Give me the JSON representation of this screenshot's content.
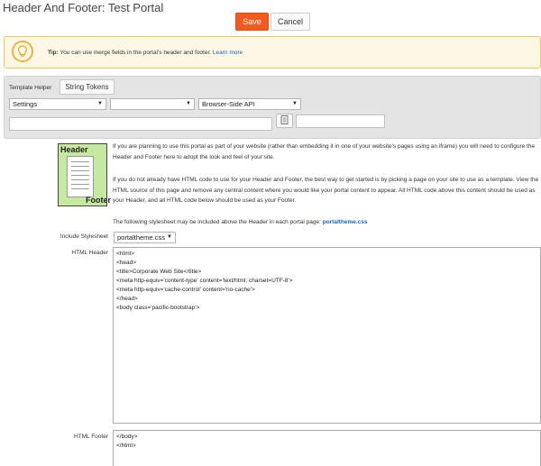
{
  "page": {
    "title": "Header And Footer: Test Portal"
  },
  "actions": {
    "save_label": "Save",
    "cancel_label": "Cancel"
  },
  "tip": {
    "prefix": "Tip:",
    "text": "You can use merge fields in the portal's header and footer.",
    "link": "Learn more"
  },
  "template_helper": {
    "label": "Template Helper",
    "tab_label": "String Tokens",
    "select1_value": "Settings",
    "select2_value": "",
    "select3_value": "Browser-Side API"
  },
  "image": {
    "header_label": "Header",
    "footer_label": "Footer"
  },
  "instructions": {
    "para1": "If you are planning to use this portal as part of your website (rather than embedding it in one of your website's pages using an iframe) you will need to configure the Header and Footer here to adopt the look and feel of your site.",
    "para2": "If you do not already have HTML code to use for your Header and Footer, the best way to get started is by picking a page on your site to use as a template. View the HTML source of this page and remove any central content where you would like your portal content to appear. All HTML code above this content should be used as your Header, and all HTML code below should be used as your Footer.",
    "para3_text": "The following stylesheet may be included above the Header in each portal page:",
    "para3_link": "portaltheme.css"
  },
  "form": {
    "stylesheet_label": "Include Stylesheet",
    "stylesheet_value": "portaltheme.css",
    "html_header_label": "HTML Header",
    "html_header_value": "<html>\n<head>\n<title>Corporate Web Site</title>\n<meta http-equiv='content-type' content='text/html; charset=UTF-8'>\n<meta http-equiv='cache-control' content='no-cache'>\n</head>\n<body class='pacific-bootstrap'>",
    "html_footer_label": "HTML Footer",
    "html_footer_value": "</body>\n</html>"
  },
  "colors": {
    "accent": "#f25a1f",
    "link": "#1565c0",
    "tip_border": "#f3c95c",
    "image_bg": "#c6e8a0"
  }
}
